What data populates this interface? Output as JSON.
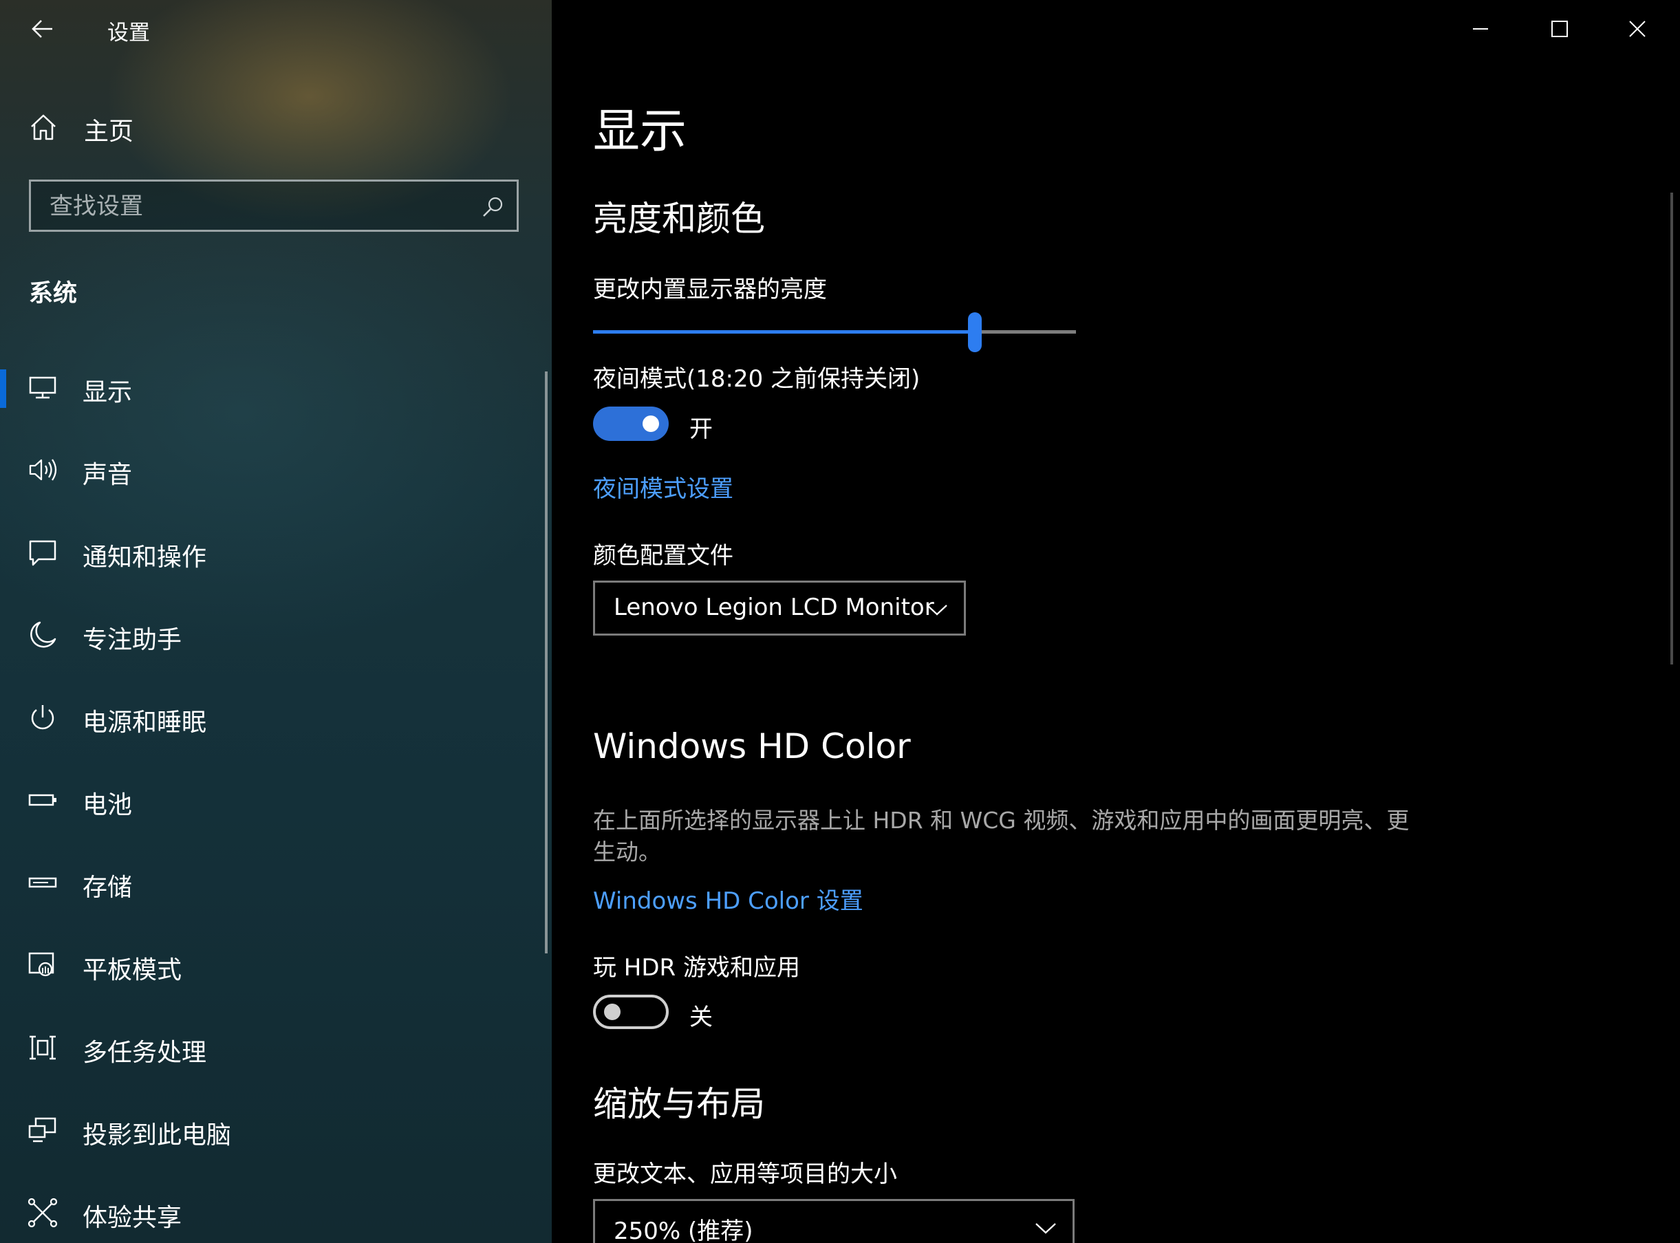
{
  "app": {
    "title": "设置"
  },
  "sidebar": {
    "home_label": "主页",
    "search_placeholder": "查找设置",
    "section_title": "系统",
    "items": [
      {
        "label": "显示",
        "icon": "monitor-icon",
        "selected": true
      },
      {
        "label": "声音",
        "icon": "speaker-icon",
        "selected": false
      },
      {
        "label": "通知和操作",
        "icon": "notification-icon",
        "selected": false
      },
      {
        "label": "专注助手",
        "icon": "moon-icon",
        "selected": false
      },
      {
        "label": "电源和睡眠",
        "icon": "power-icon",
        "selected": false
      },
      {
        "label": "电池",
        "icon": "battery-icon",
        "selected": false
      },
      {
        "label": "存储",
        "icon": "storage-icon",
        "selected": false
      },
      {
        "label": "平板模式",
        "icon": "tablet-mode-icon",
        "selected": false
      },
      {
        "label": "多任务处理",
        "icon": "multitasking-icon",
        "selected": false
      },
      {
        "label": "投影到此电脑",
        "icon": "project-icon",
        "selected": false
      },
      {
        "label": "体验共享",
        "icon": "shared-experiences-icon",
        "selected": false
      }
    ]
  },
  "main": {
    "page_title": "显示",
    "brightness_section": {
      "heading": "亮度和颜色",
      "brightness_label": "更改内置显示器的亮度",
      "brightness_value": 79,
      "night_light_label": "夜间模式(18:20 之前保持关闭)",
      "night_light_state": "开",
      "night_light_on": true,
      "night_light_link": "夜间模式设置",
      "color_profile_label": "颜色配置文件",
      "color_profile_value": "Lenovo Legion LCD Monitor"
    },
    "hd_color_section": {
      "heading": "Windows HD Color",
      "description": "在上面所选择的显示器上让 HDR 和 WCG 视频、游戏和应用中的画面更明亮、更生动。",
      "link": "Windows HD Color 设置",
      "hdr_label": "玩 HDR 游戏和应用",
      "hdr_state": "关",
      "hdr_on": false
    },
    "scale_section": {
      "heading": "缩放与布局",
      "scale_label": "更改文本、应用等项目的大小",
      "scale_value": "250% (推荐)"
    }
  },
  "colors": {
    "accent": "#2d7df0",
    "link": "#4d9fff",
    "background": "#000000"
  }
}
